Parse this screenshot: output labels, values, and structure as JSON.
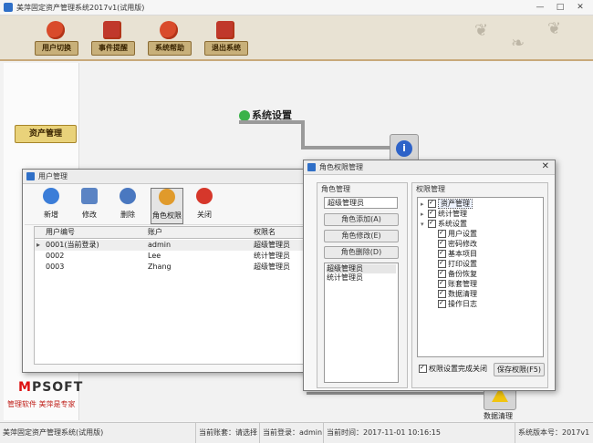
{
  "window": {
    "title": "美萍固定资产管理系统2017v1(试用版)",
    "controls": [
      "—",
      "□",
      "✕"
    ]
  },
  "toolbar": {
    "buttons": [
      {
        "label": "用户切换",
        "icon": "user-switch-icon"
      },
      {
        "label": "事件提醒",
        "icon": "alarm-icon"
      },
      {
        "label": "系统帮助",
        "icon": "help-icon"
      },
      {
        "label": "退出系统",
        "icon": "power-icon"
      }
    ]
  },
  "sidebar": {
    "asset_button": "资产管理",
    "logo_prefix": "M",
    "logo_rest": "PSOFT",
    "slogan": "管理软件  美萍是专家"
  },
  "workspace": {
    "section_title": "系统设置",
    "data_clean_label": "数据清理"
  },
  "user_mgmt": {
    "title": "用户管理",
    "tools": [
      {
        "label": "新增",
        "color": "#3b7dd8"
      },
      {
        "label": "修改",
        "color": "#5b84c4"
      },
      {
        "label": "删除",
        "color": "#4a78c0"
      },
      {
        "label": "角色权限",
        "color": "#e09a2b"
      },
      {
        "label": "关闭",
        "color": "#d6372b"
      }
    ],
    "columns": [
      "用户编号",
      "账户",
      "权限名"
    ],
    "rows": [
      [
        "0001(当前登录)",
        "admin",
        "超级管理员"
      ],
      [
        "0002",
        "Lee",
        "统计管理员"
      ],
      [
        "0003",
        "Zhang",
        "超级管理员"
      ]
    ]
  },
  "role_perm": {
    "title": "角色权限管理",
    "role_group_title": "角色管理",
    "role_name": "超级管理员",
    "buttons": [
      "角色添加(A)",
      "角色修改(E)",
      "角色删除(D)"
    ],
    "roles": [
      "超级管理员",
      "统计管理员"
    ],
    "perm_group_title": "权限管理",
    "tree": [
      {
        "label": "资产管理",
        "level": 0,
        "exp": "▸"
      },
      {
        "label": "统计管理",
        "level": 0,
        "exp": "▸"
      },
      {
        "label": "系统设置",
        "level": 0,
        "exp": "▾"
      },
      {
        "label": "用户设置",
        "level": 1
      },
      {
        "label": "密码修改",
        "level": 1
      },
      {
        "label": "基本项目",
        "level": 1
      },
      {
        "label": "打印设置",
        "level": 1
      },
      {
        "label": "备份恢复",
        "level": 1
      },
      {
        "label": "账套管理",
        "level": 1
      },
      {
        "label": "数据清理",
        "level": 1
      },
      {
        "label": "操作日志",
        "level": 1
      }
    ],
    "close_checkbox_label": "权限设置完成关闭",
    "save_label": "保存权限(F5)"
  },
  "status": {
    "app": "美萍固定资产管理系统(试用版)",
    "account": "当前账套：请选择",
    "login": "当前登录：admin",
    "time": "当前时间：2017-11-01 10:16:15",
    "version": "系统版本号：2017v1"
  }
}
